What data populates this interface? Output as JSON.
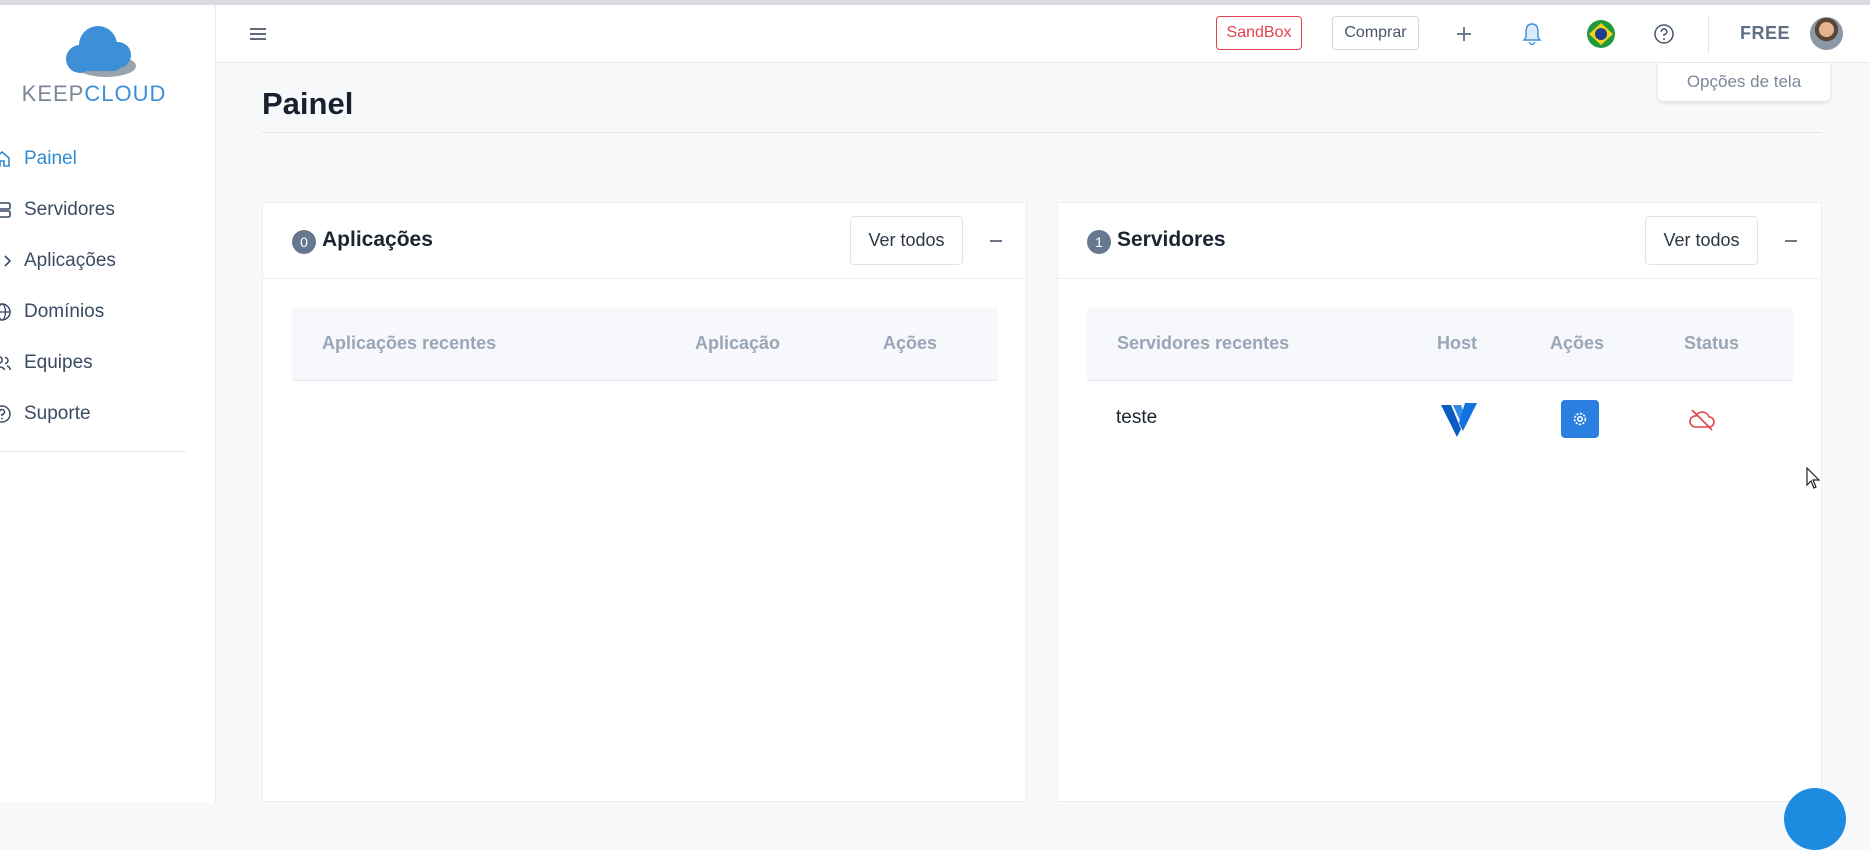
{
  "brand": {
    "logo_part1": "KEEP",
    "logo_part2": "CLOUD"
  },
  "sidebar": {
    "items": [
      {
        "label": "Painel",
        "icon": "home-icon",
        "active": true
      },
      {
        "label": "Servidores",
        "icon": "server-icon",
        "active": false
      },
      {
        "label": "Aplicações",
        "icon": "code-icon",
        "active": false
      },
      {
        "label": "Domínios",
        "icon": "globe-icon",
        "active": false
      },
      {
        "label": "Equipes",
        "icon": "users-icon",
        "active": false
      },
      {
        "label": "Suporte",
        "icon": "help-icon",
        "active": false
      }
    ]
  },
  "topbar": {
    "sandbox_label": "SandBox",
    "buy_label": "Comprar",
    "plan_label": "FREE",
    "icons": [
      "menu-icon",
      "plus-icon",
      "bell-icon",
      "brazil-flag-icon",
      "help-icon",
      "avatar"
    ]
  },
  "screen_options_label": "Opções de tela",
  "page": {
    "title": "Painel"
  },
  "apps_card": {
    "count": "0",
    "title": "Aplicações",
    "view_all": "Ver todos",
    "columns": [
      "Aplicações recentes",
      "Aplicação",
      "Ações"
    ],
    "rows": []
  },
  "servers_card": {
    "count": "1",
    "title": "Servidores",
    "view_all": "Ver todos",
    "columns": [
      "Servidores recentes",
      "Host",
      "Ações",
      "Status"
    ],
    "rows": [
      {
        "name": "teste",
        "host_icon": "vultr-logo-icon",
        "action_icon": "gear-icon",
        "status_icon": "cloud-offline-icon"
      }
    ]
  },
  "colors": {
    "accent": "#2f8bd2",
    "sandbox": "#e2434b",
    "action_button": "#2a7fe0",
    "status_offline": "#e2434b",
    "badge": "#66788f"
  }
}
